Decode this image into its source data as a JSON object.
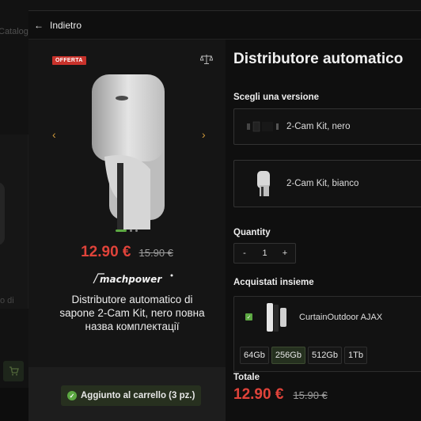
{
  "background": {
    "catalog_label": "Catalog",
    "partial_text": "o di",
    "cart_icon": "cart-icon"
  },
  "header": {
    "back_icon": "arrow-left-icon",
    "back_label": "Indietro"
  },
  "gallery": {
    "badge": "OFFERTA",
    "compare_icon": "scale-icon",
    "prev_icon": "chevron-left-icon",
    "next_icon": "chevron-right-icon",
    "dots_count": 3,
    "active_dot": 0
  },
  "product": {
    "title": "Distributore automatico di sapone 2-Cam Kit, nero повна назва комплектації",
    "title_short": "Distributore automatico",
    "price": "12.90 €",
    "old_price": "15.90 €",
    "brand": "machpower"
  },
  "toast": {
    "icon": "check-circle-icon",
    "label": "Aggiunto al carrello (3 pz.)"
  },
  "versions": {
    "label": "Scegli una versione",
    "items": [
      {
        "label": "2-Cam Kit, nero"
      },
      {
        "label": "2-Cam Kit, bianco"
      }
    ]
  },
  "quantity": {
    "label": "Quantity",
    "minus": "-",
    "value": "1",
    "plus": "+"
  },
  "bundle": {
    "label": "Acquistati insieme",
    "item_label": "CurtainOutdoor AJAX",
    "checked": true,
    "variants": [
      "64Gb",
      "256Gb",
      "512Gb",
      "1Tb"
    ],
    "selected_variant": "256Gb"
  },
  "total": {
    "label": "Totale",
    "price": "12.90 €",
    "old_price": "15.90 €"
  },
  "colors": {
    "accent_green": "#5ca842",
    "price_red": "#e0433a",
    "nav_orange": "#d19a3b",
    "badge_red": "#c8322b"
  }
}
